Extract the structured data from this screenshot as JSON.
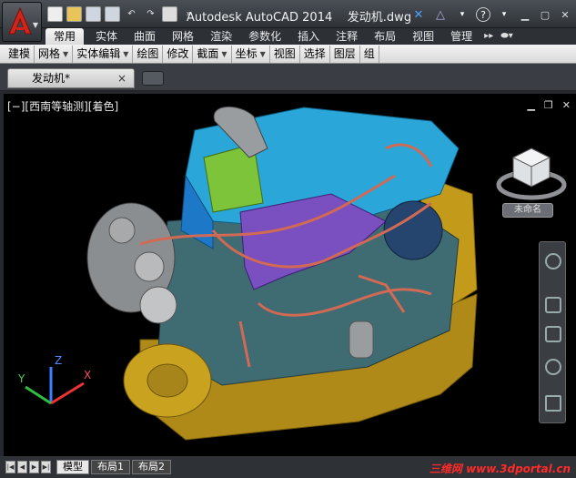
{
  "app": {
    "title": "Autodesk AutoCAD 2014",
    "file": "发动机.dwg"
  },
  "ribbon": {
    "tabs": [
      "常用",
      "实体",
      "曲面",
      "网格",
      "渲染",
      "参数化",
      "插入",
      "注释",
      "布局",
      "视图",
      "管理"
    ],
    "active_tab": "常用"
  },
  "toolbar": {
    "groups": [
      "建模",
      "网格",
      "实体编辑",
      "绘图",
      "修改",
      "截面",
      "坐标",
      "视图",
      "选择",
      "图层",
      "组"
    ]
  },
  "document_tab": {
    "label": "发动机*"
  },
  "viewport": {
    "label": "[−][西南等轴测][着色]",
    "wcs_label": "未命名"
  },
  "ucs": {
    "x": "X",
    "y": "Y",
    "z": "Z"
  },
  "layout_tabs": [
    "模型",
    "布局1",
    "布局2"
  ],
  "watermark": "三维网 www.3dportal.cn",
  "colors": {
    "accent_red": "#d0251c",
    "engine_blue": "#2aa7d8",
    "engine_gold": "#c49a1a",
    "engine_purple": "#7a4fc0"
  }
}
